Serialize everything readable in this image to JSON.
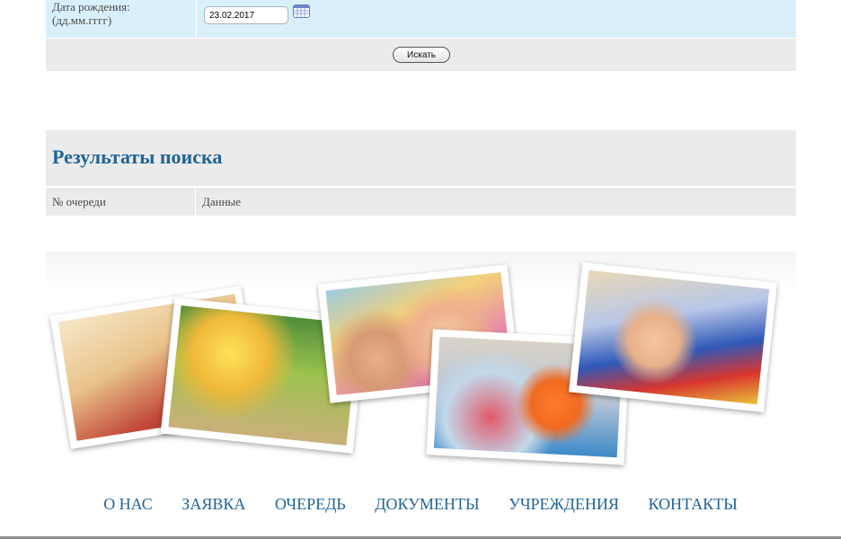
{
  "form": {
    "birth_label": "Дата рождения:",
    "birth_format": "(дд.мм.гггг)",
    "birth_value": "23.02.2017",
    "calendar_icon": "calendar-icon",
    "search_button": "Искать"
  },
  "results": {
    "title": "Результаты поиска",
    "columns": [
      "№ очереди",
      "Данные"
    ]
  },
  "nav": {
    "items": [
      "О НАС",
      "ЗАЯВКА",
      "ОЧЕРЕДЬ",
      "ДОКУМЕНТЫ",
      "УЧРЕЖДЕНИЯ",
      "КОНТАКТЫ"
    ]
  },
  "colors": {
    "accent": "#1f6597",
    "form_background": "#d9f0fb",
    "panel_background": "#ebebeb"
  }
}
